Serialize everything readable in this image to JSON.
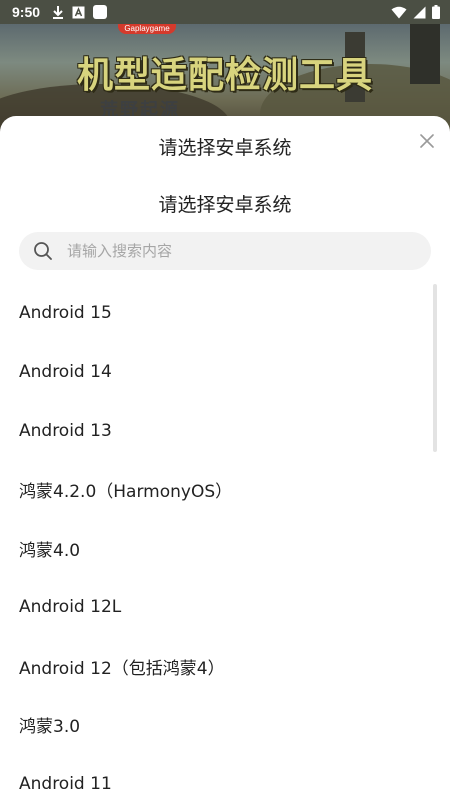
{
  "status_bar": {
    "time": "9:50",
    "left_icons": [
      "download-icon",
      "a-box-icon",
      "white-square-icon"
    ],
    "right_icons": [
      "wifi-icon",
      "cell-signal-icon",
      "battery-icon"
    ]
  },
  "banner": {
    "logo_text": "Gaplaygame",
    "title": "机型适配检测工具",
    "subtitle": "荒野起源"
  },
  "sheet": {
    "title": "请选择安卓系统",
    "subtitle": "请选择安卓系统",
    "close_icon": "close-icon",
    "search": {
      "placeholder": "请输入搜索内容",
      "value": ""
    },
    "options": [
      "Android 15",
      "Android 14",
      "Android 13",
      "鸿蒙4.2.0（HarmonyOS）",
      "鸿蒙4.0",
      "Android 12L",
      "Android 12（包括鸿蒙4）",
      "鸿蒙3.0",
      "Android 11"
    ]
  },
  "colors": {
    "sheet_bg": "#ffffff",
    "search_bg": "#f2f2f2",
    "text": "#222222",
    "placeholder": "#a6a6a6",
    "banner_title": "#d8d47e"
  }
}
